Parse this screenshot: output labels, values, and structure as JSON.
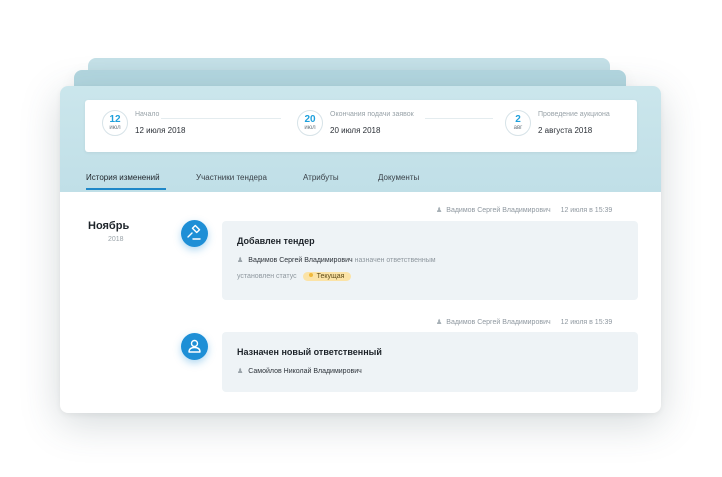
{
  "dates": [
    {
      "day": "12",
      "month": "июл",
      "label": "Начало",
      "value": "12 июля 2018"
    },
    {
      "day": "20",
      "month": "июл",
      "label": "Окончания подачи заявок",
      "value": "20 июля 2018"
    },
    {
      "day": "2",
      "month": "авг",
      "label": "Проведение аукциона",
      "value": "2 августа 2018"
    }
  ],
  "tabs": [
    {
      "label": "История изменений",
      "active": true
    },
    {
      "label": "Участники тендера",
      "active": false
    },
    {
      "label": "Атрибуты",
      "active": false
    },
    {
      "label": "Документы",
      "active": false
    }
  ],
  "timeline": {
    "month": "Ноябрь",
    "year": "2018"
  },
  "events": [
    {
      "author": "Вадимов Сергей Владимирович",
      "time": "12 июля в 15:39",
      "icon": "gavel-icon",
      "title": "Добавлен тендер",
      "person": "Вадимов Сергей Владимирович",
      "person_action": "назначен ответственным",
      "status_text": "установлен статус",
      "status_badge": "Текущая"
    },
    {
      "author": "Вадимов Сергей Владимирович",
      "time": "12 июля в 15:39",
      "icon": "user-icon",
      "title": "Назначен новый ответственный",
      "person": "Самойлов Николай Владимирович"
    }
  ],
  "colors": {
    "accent": "#1e8fd6",
    "header_bg": "#c4e2e9",
    "badge_bg": "#fbe3a7"
  }
}
